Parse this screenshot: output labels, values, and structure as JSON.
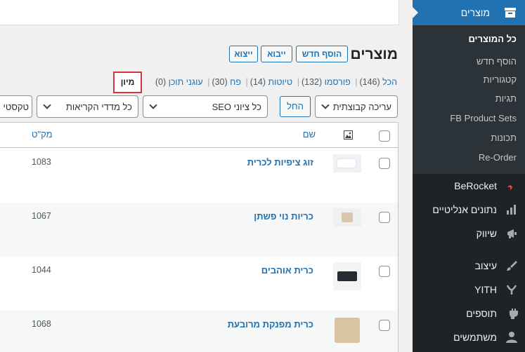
{
  "sidebar": {
    "top_item": {
      "label": "מוצרים",
      "icon": "archive-icon"
    },
    "submenu": [
      "כל המוצרים",
      "הוסף חדש",
      "קטגוריות",
      "תגיות",
      "FB Product Sets",
      "תכונות",
      "Re-Order"
    ],
    "items": [
      {
        "label": "BeRocket",
        "icon": "rocket-icon"
      },
      {
        "label": "נתונים אנליטיים",
        "icon": "bar-chart-icon"
      },
      {
        "label": "שיווק",
        "icon": "megaphone-icon"
      },
      {
        "label": "עיצוב",
        "icon": "paintbrush-icon"
      },
      {
        "label": "YITH",
        "icon": "yith-logo-icon"
      },
      {
        "label": "תוספים",
        "icon": "plugin-icon"
      },
      {
        "label": "משתמשים",
        "icon": "user-icon"
      }
    ]
  },
  "header": {
    "title": "מוצרים",
    "add_new": "הוסף חדש",
    "import": "ייבוא",
    "export": "ייצוא"
  },
  "views": {
    "all": "הכל",
    "all_count": "(146)",
    "published": "פורסמו",
    "published_count": "(132)",
    "drafts": "טיוטות",
    "drafts_count": "(14)",
    "trash": "פח",
    "trash_count": "(30)",
    "anchors": "עוגני תוכן",
    "anchors_count": "(0)",
    "sort": "מיון"
  },
  "filters": {
    "bulk_action": "עריכה קבוצתית",
    "apply": "החל",
    "seo": "כל ציוני SEO",
    "readability": "כל מדדי הקריאות",
    "text": "טקסטי"
  },
  "table": {
    "col_name": "שם",
    "col_sku": "מק\"ט",
    "rows": [
      {
        "name": "זוג ציפיות לכרית",
        "sku": "1083"
      },
      {
        "name": "כריות נוי פשתן",
        "sku": "1067"
      },
      {
        "name": "כרית אוהבים",
        "sku": "1044"
      },
      {
        "name": "כרית מפנקת מרובעת",
        "sku": "1068"
      }
    ]
  },
  "colors": {
    "accent": "#2271b1",
    "sidebar": "#1d2327",
    "submenu": "#2c3338",
    "highlight": "#d63638"
  }
}
